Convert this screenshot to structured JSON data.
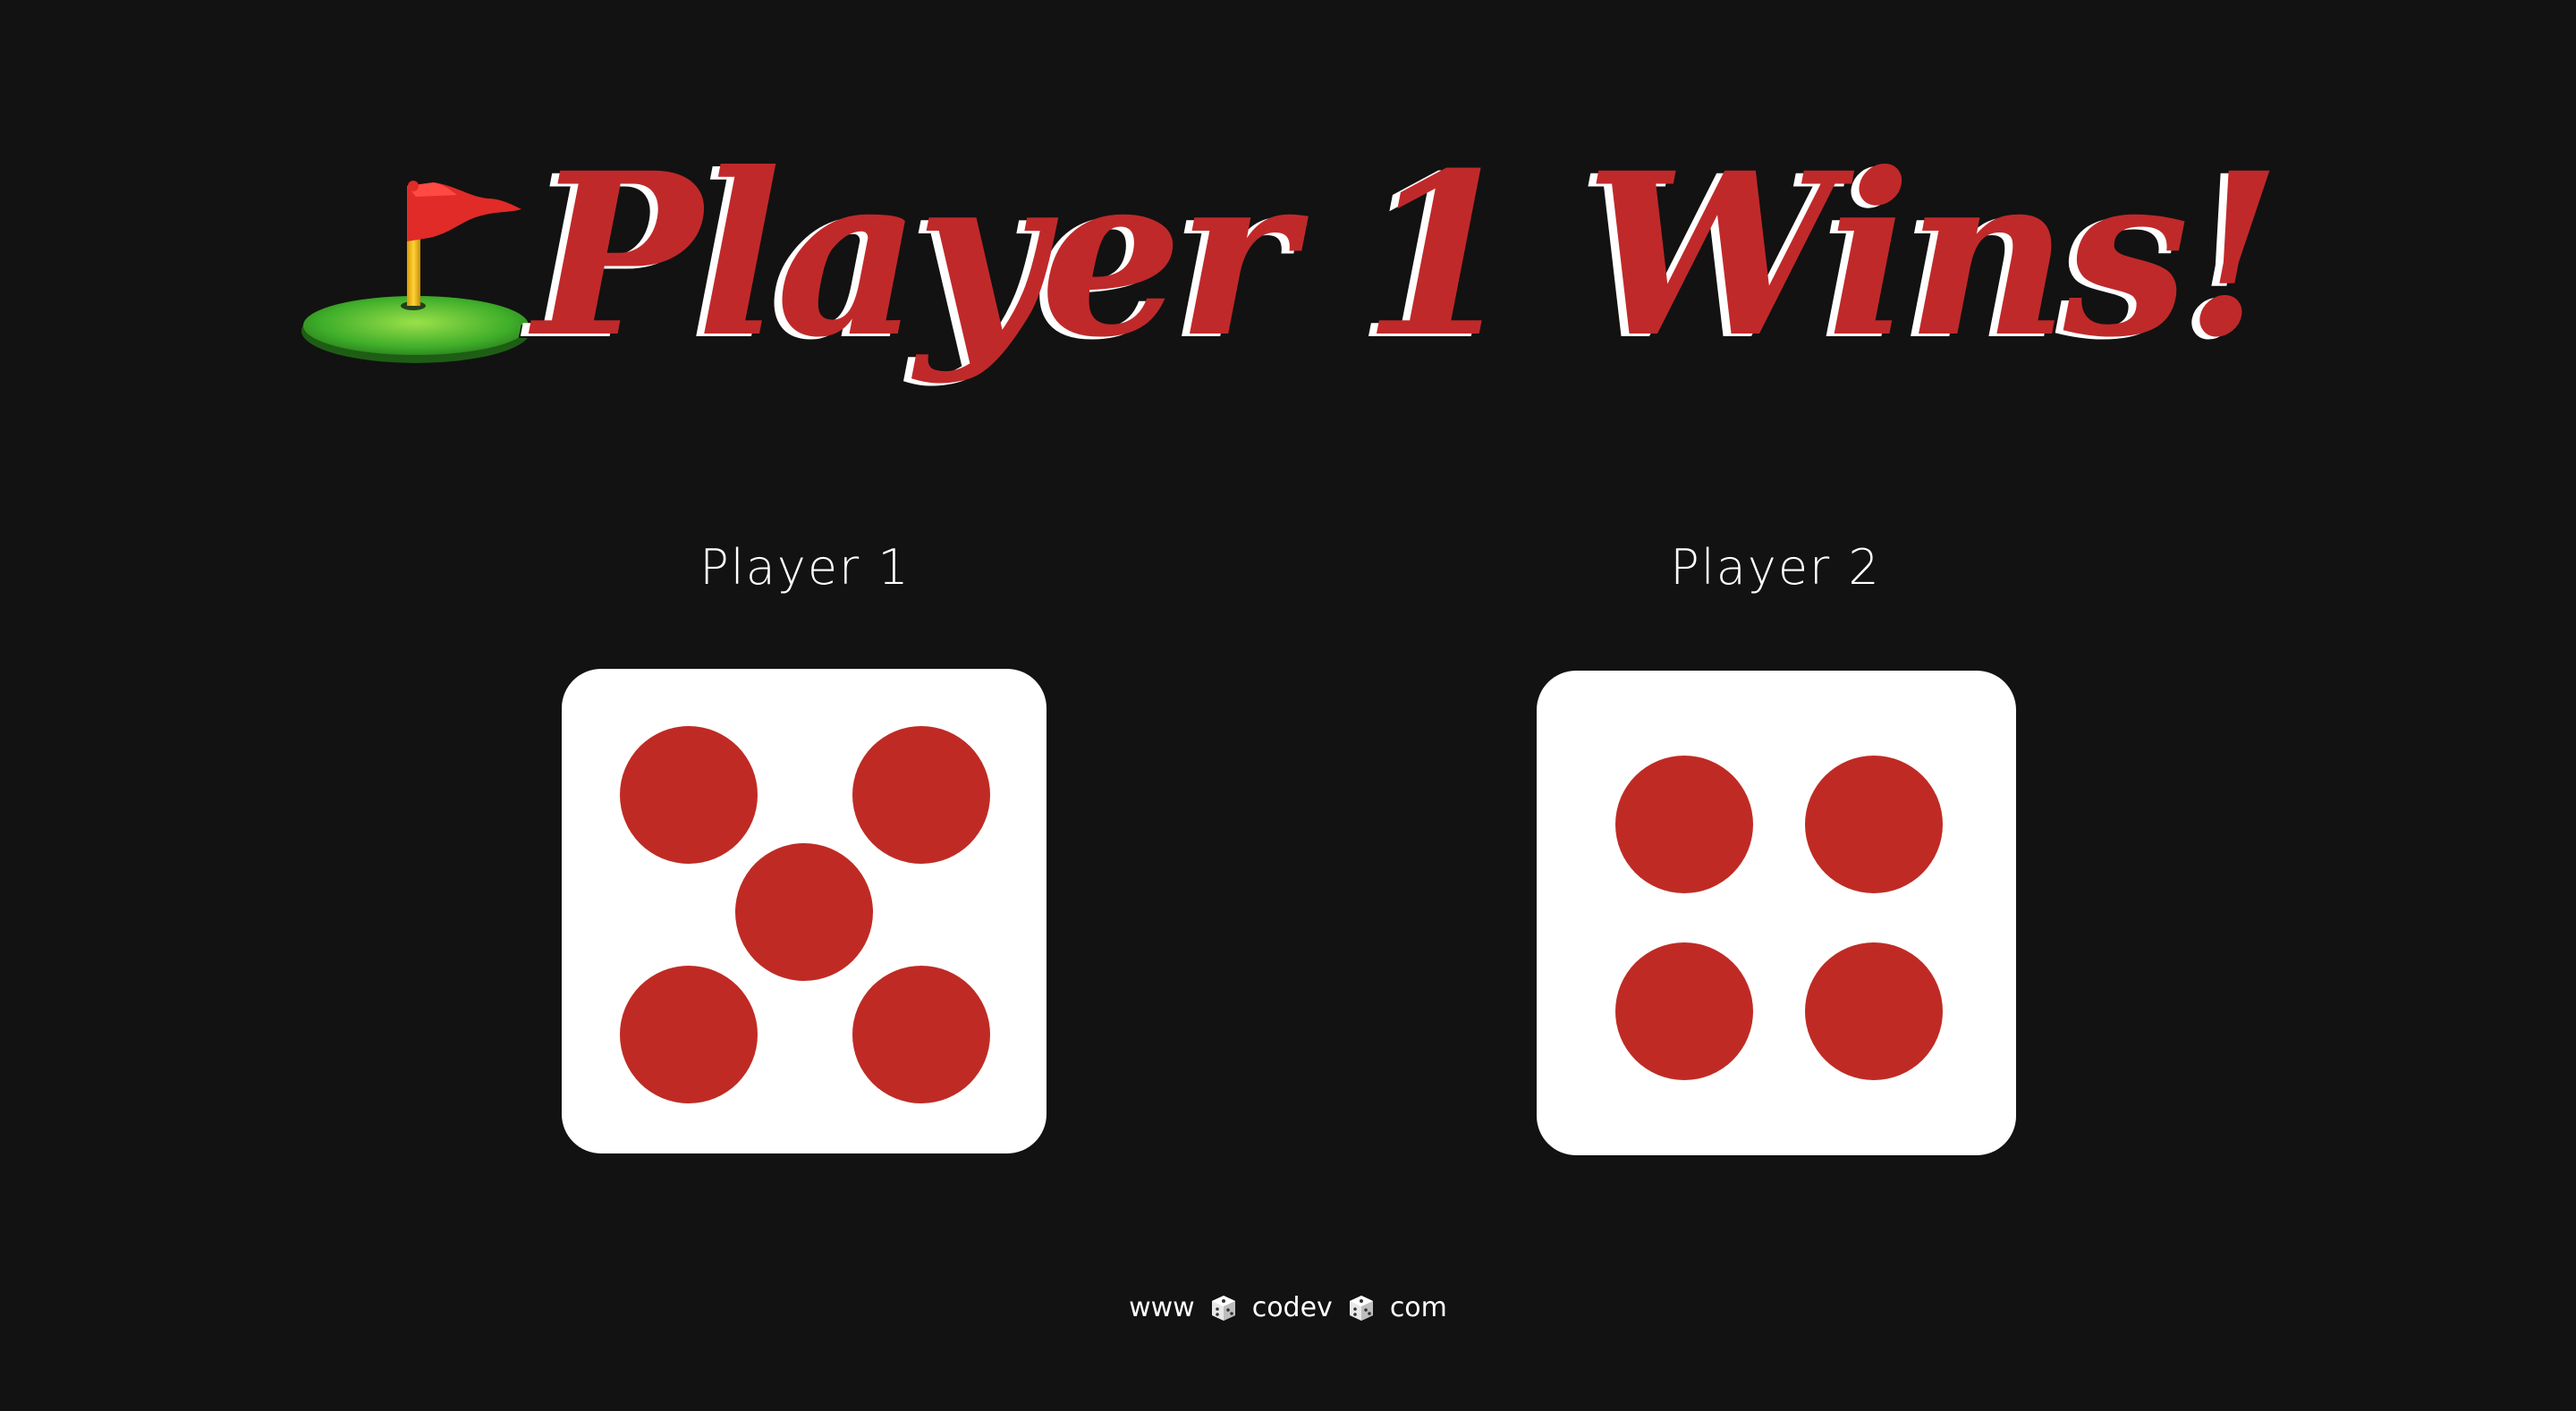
{
  "title": {
    "icon": "flag-in-hole-icon",
    "text": "Player 1 Wins!"
  },
  "players": [
    {
      "label": "Player 1",
      "die_value": 5
    },
    {
      "label": "Player 2",
      "die_value": 4
    }
  ],
  "footer": {
    "part1": "www",
    "part2": "codev",
    "part3": "com",
    "separator_icon": "die-icon"
  },
  "colors": {
    "background": "#121212",
    "accent": "#c0292a",
    "pip": "#bf2b24",
    "die_face": "#ffffff"
  }
}
